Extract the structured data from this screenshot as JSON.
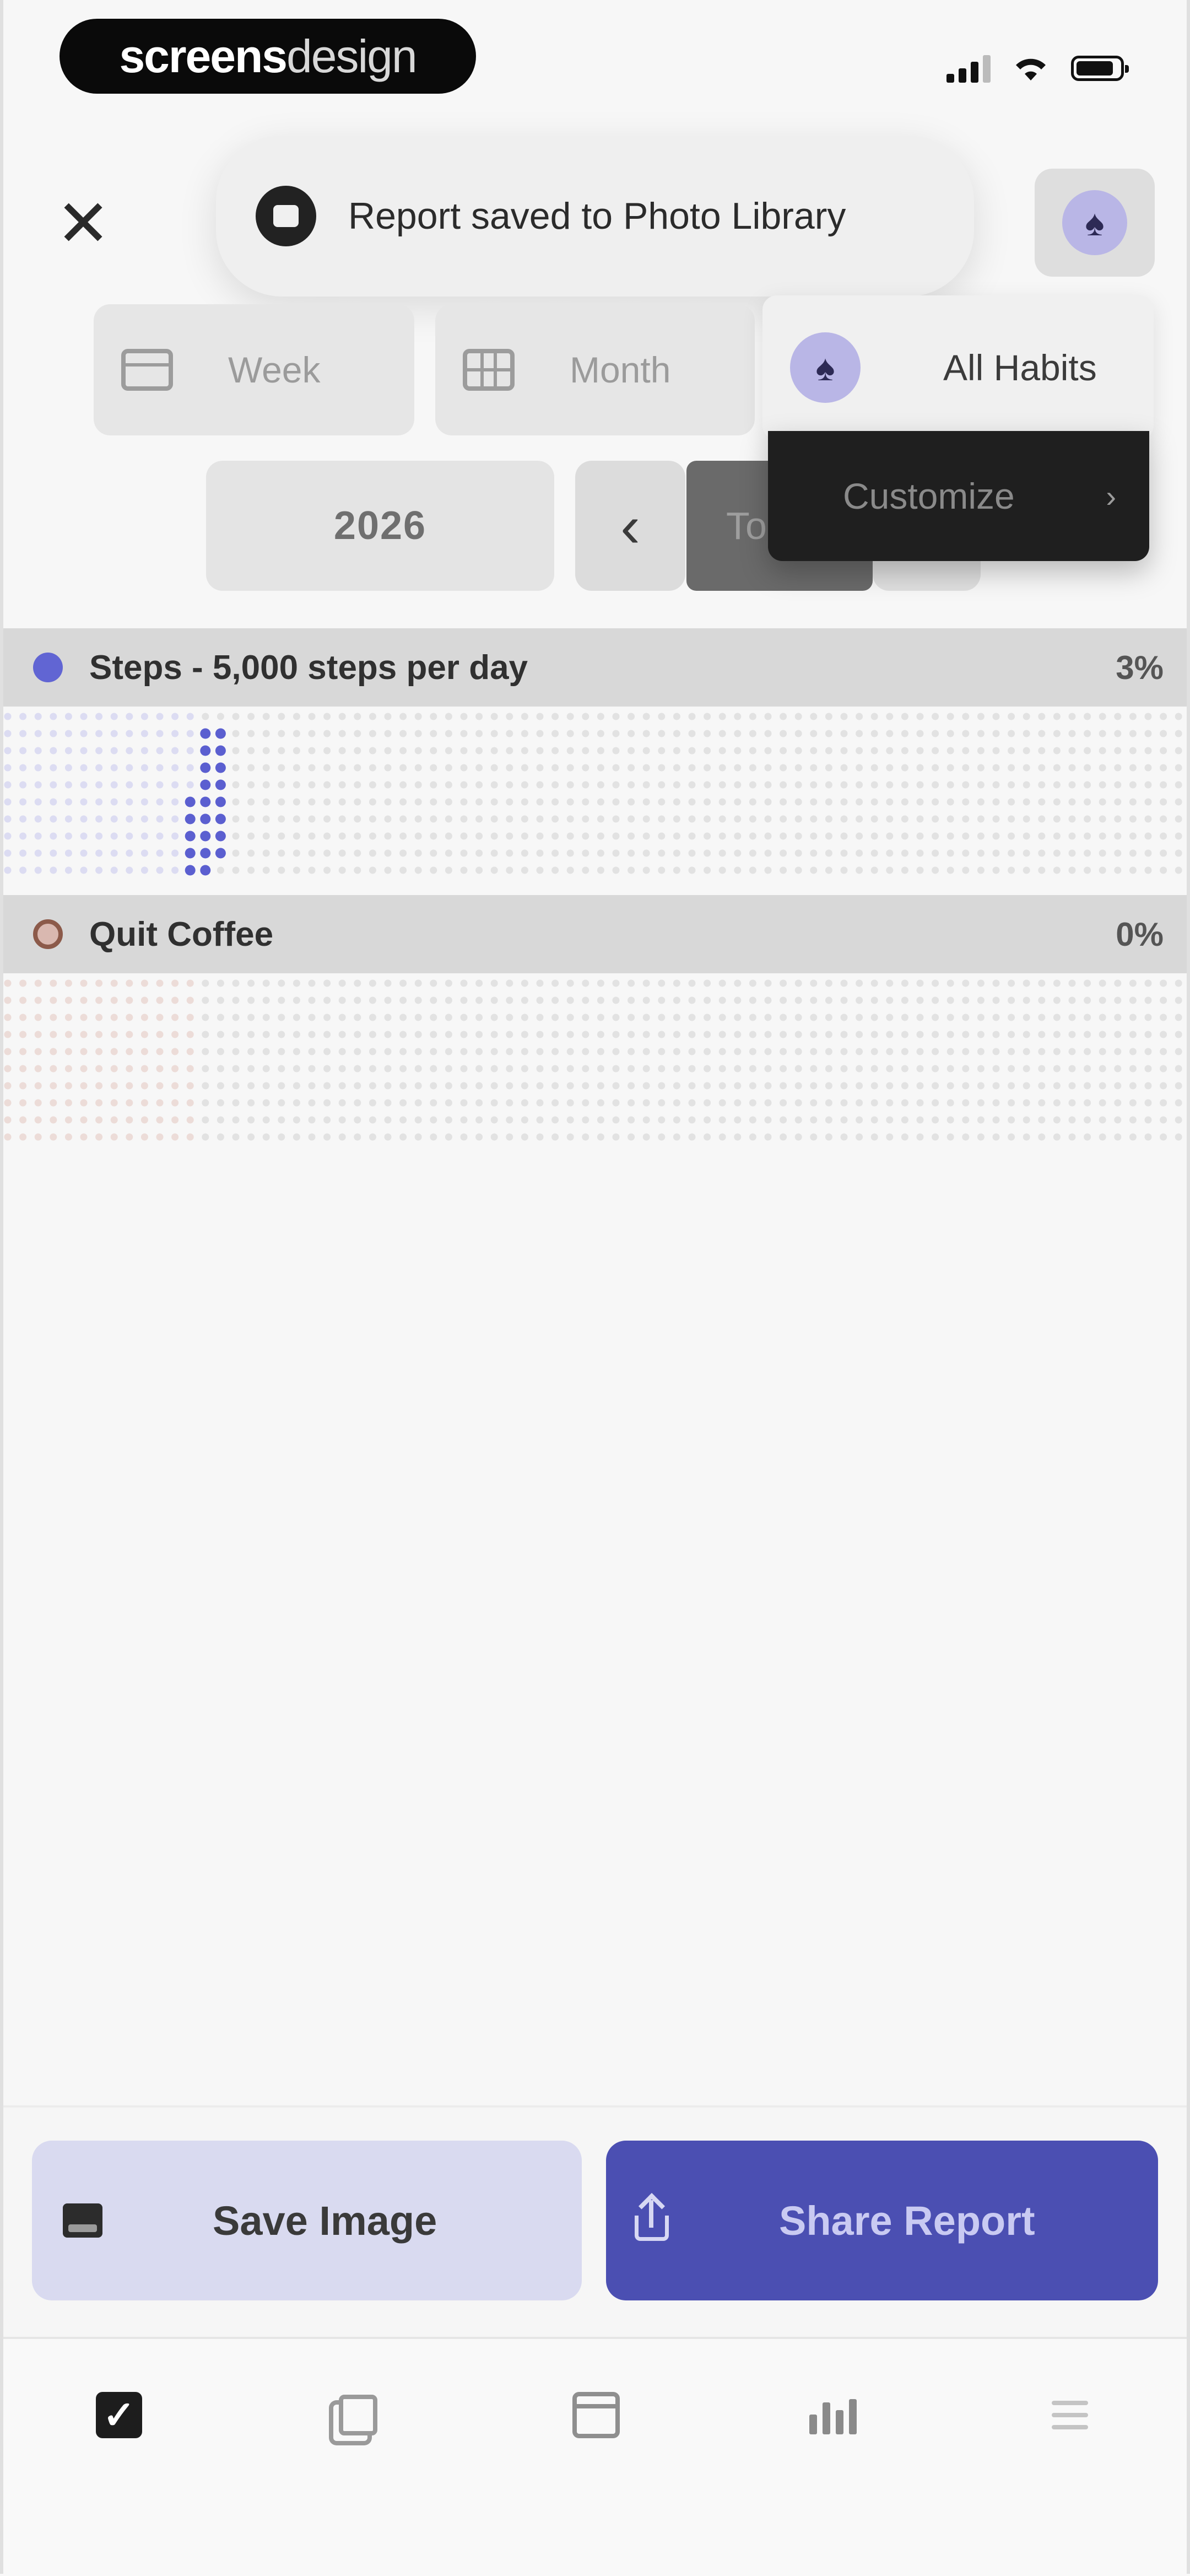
{
  "status_bar": {
    "brand_bold": "screens",
    "brand_light": "design"
  },
  "header": {
    "close_icon": "close-icon",
    "toast": {
      "text": "Report saved to Photo Library",
      "icon": "photo-icon"
    },
    "avatar_icon": "leaf-icon"
  },
  "view_switcher": {
    "week_label": "Week",
    "month_label": "Month",
    "habits_filter_label": "All Habits"
  },
  "period_nav": {
    "year_label": "2026",
    "prev_icon": "chevron-left-icon",
    "today_label": "To"
  },
  "dropdown_menu": {
    "items": [
      {
        "label": "Customize",
        "icon": "chevron-right-icon"
      }
    ]
  },
  "habits": [
    {
      "name": "Steps - 5,000 steps per day",
      "percent": "3%",
      "color": "#5b5fd0",
      "completed_cells": [
        [
          13,
          1
        ],
        [
          13,
          2
        ],
        [
          13,
          3
        ],
        [
          13,
          4
        ],
        [
          13,
          5
        ],
        [
          13,
          6
        ],
        [
          13,
          7
        ],
        [
          13,
          8
        ],
        [
          13,
          9
        ],
        [
          14,
          1
        ],
        [
          14,
          2
        ],
        [
          14,
          3
        ],
        [
          14,
          4
        ],
        [
          14,
          5
        ],
        [
          14,
          6
        ],
        [
          14,
          7
        ],
        [
          14,
          8
        ],
        [
          12,
          5
        ],
        [
          12,
          6
        ],
        [
          12,
          7
        ],
        [
          12,
          8
        ],
        [
          12,
          9
        ]
      ]
    },
    {
      "name": "Quit Coffee",
      "percent": "0%",
      "color": "#8c5a4a",
      "completed_cells": []
    }
  ],
  "actions": {
    "save_label": "Save Image",
    "share_label": "Share Report"
  },
  "tab_bar": {
    "items": [
      "check-icon",
      "journal-icon",
      "calendar-icon",
      "stats-icon",
      "settings-icon"
    ]
  },
  "colors": {
    "accent": "#4b4fb2",
    "accent_light": "#d9daf0",
    "header_grey": "#d8d8d8"
  }
}
